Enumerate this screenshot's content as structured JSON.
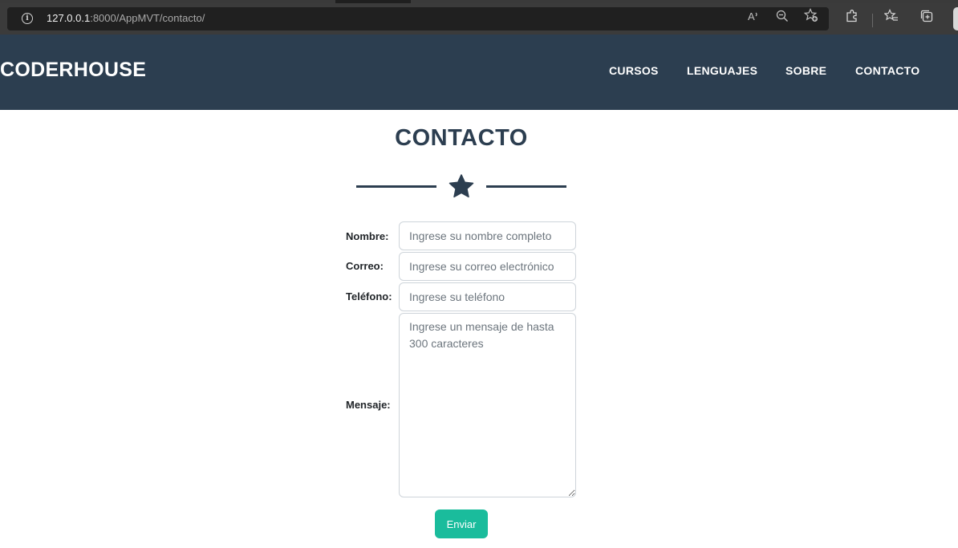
{
  "browser": {
    "url_host": "127.0.0.1",
    "url_rest": ":8000/AppMVT/contacto/",
    "icons": [
      "info-icon",
      "read-aloud-icon",
      "zoom-out-icon",
      "add-favorite-icon",
      "extensions-icon",
      "favorites-icon",
      "collections-icon"
    ]
  },
  "navbar": {
    "brand": "CODERHOUSE",
    "links": [
      "CURSOS",
      "LENGUAJES",
      "SOBRE",
      "CONTACTO"
    ]
  },
  "page": {
    "title": "CONTACTO",
    "divider_icon": "star-icon"
  },
  "form": {
    "fields": [
      {
        "label": "Nombre:",
        "placeholder": "Ingrese su nombre completo",
        "value": ""
      },
      {
        "label": "Correo:",
        "placeholder": "Ingrese su correo electrónico",
        "value": ""
      },
      {
        "label": "Teléfono:",
        "placeholder": "Ingrese su teléfono",
        "value": ""
      },
      {
        "label": "Mensaje:",
        "placeholder": "Ingrese un mensaje de hasta 300 caracteres",
        "value": ""
      }
    ],
    "submit_label": "Enviar"
  },
  "colors": {
    "navbar_bg": "#2c3e50",
    "primary_text": "#2c3e50",
    "accent": "#1abc9c"
  }
}
